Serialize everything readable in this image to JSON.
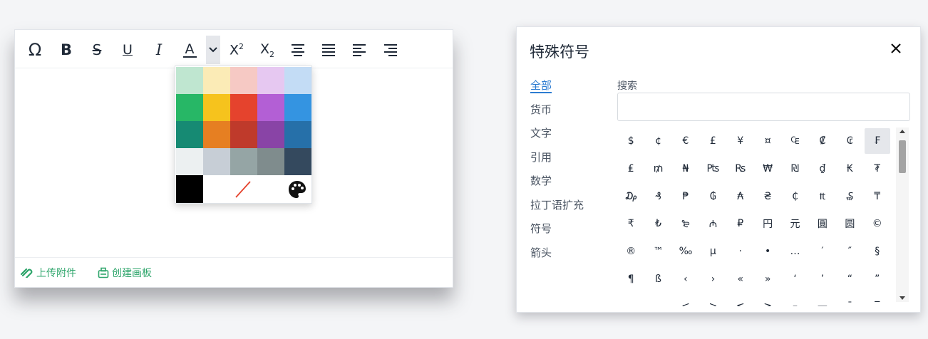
{
  "editor": {
    "toolbar": {
      "omega": "Ω",
      "bold": "B",
      "strike": "S",
      "underline": "U",
      "italic": "I",
      "font_color": "A",
      "sup_base": "X",
      "sup_mark": "2",
      "sub_base": "X",
      "sub_mark": "2"
    },
    "footer": {
      "upload": "上传附件",
      "board": "创建画板"
    }
  },
  "color_picker": {
    "swatches": [
      "#bfe6d0",
      "#fbebb6",
      "#f6c9c4",
      "#e6c8f1",
      "#c3dcf5",
      "#27b766",
      "#f6c31d",
      "#e5432d",
      "#b35fd5",
      "#3494e1",
      "#168a73",
      "#e67f22",
      "#bf3a2b",
      "#8944a6",
      "#2670a9",
      "#ecf0f1",
      "#c7ced6",
      "#95a5a5",
      "#7f8c8d",
      "#34495e"
    ],
    "black": "#000000",
    "no_color_line": "#e5432d"
  },
  "dialog": {
    "title": "特殊符号",
    "categories": [
      "全部",
      "货币",
      "文字",
      "引用",
      "数学",
      "拉丁语扩充",
      "符号",
      "箭头"
    ],
    "search_label": "搜索",
    "search_value": "",
    "symbols": [
      "$",
      "¢",
      "€",
      "£",
      "¥",
      "¤",
      "₠",
      "₡",
      "₢",
      "₣",
      "₤",
      "₥",
      "₦",
      "₧",
      "₨",
      "₩",
      "₪",
      "₫",
      "₭",
      "₮",
      "₯",
      "₰",
      "₱",
      "₲",
      "₳",
      "₴",
      "₵",
      "₶",
      "₷",
      "₸",
      "₹",
      "₺",
      "₻",
      "₼",
      "₽",
      "円",
      "元",
      "圓",
      "圆",
      "©",
      "®",
      "™",
      "‰",
      "μ",
      "·",
      "•",
      "…",
      "′",
      "″",
      "§",
      "¶",
      "ß",
      "‹",
      "›",
      "«",
      "»",
      "‘",
      "’",
      "“",
      "”",
      "‚",
      "„",
      "<",
      ">",
      "≤",
      "≥",
      "–",
      "—",
      "¯",
      "‾"
    ],
    "selected_symbol": "₣",
    "accent": "#2d7cd1"
  }
}
